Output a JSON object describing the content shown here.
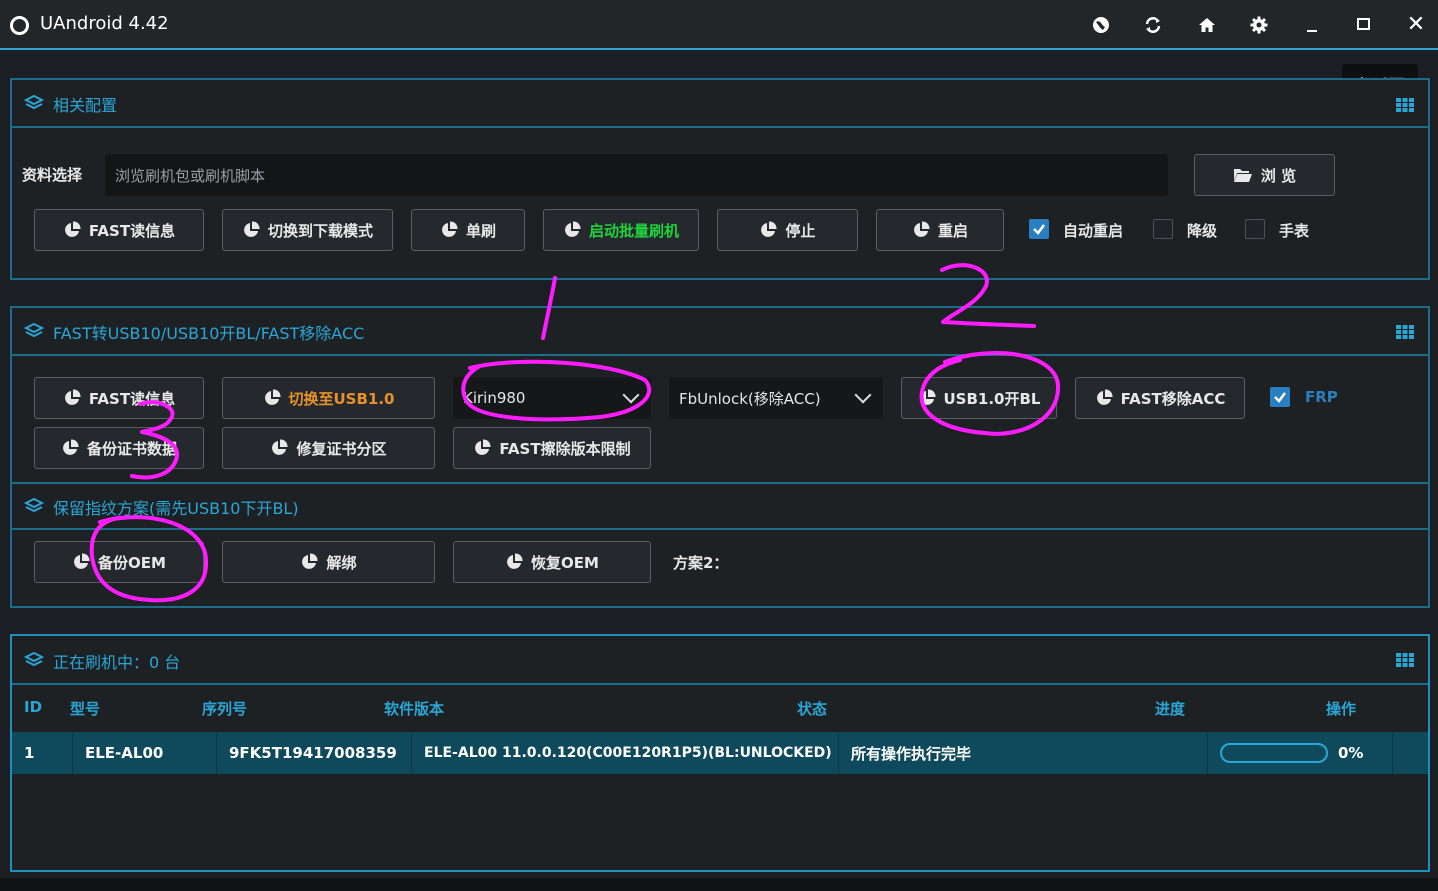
{
  "app": {
    "title": "UAndroid 4.42"
  },
  "titlebar_icons": [
    "globe-icon",
    "refresh-icon",
    "home-icon",
    "gear-icon",
    "minimize-icon",
    "maximize-icon",
    "close-icon"
  ],
  "back_button": {
    "label": "返回"
  },
  "config_panel": {
    "title": "相关配置",
    "file_label": "资料选择",
    "file_placeholder": "浏览刷机包或刷机脚本",
    "browse_label": "浏 览",
    "buttons": [
      "FAST读信息",
      "切换到下载模式",
      "单刷",
      "启动批量刷机",
      "停止",
      "重启"
    ],
    "checkboxes": [
      {
        "label": "自动重启",
        "checked": true
      },
      {
        "label": "降级",
        "checked": false
      },
      {
        "label": "手表",
        "checked": false
      }
    ]
  },
  "fast_panel": {
    "title": "FAST转USB10/USB10开BL/FAST移除ACC",
    "row1_buttons": [
      "FAST读信息",
      "切换至USB1.0"
    ],
    "chip_select": "Kirin980",
    "mode_select": "FbUnlock(移除ACC)",
    "row1_buttons_right": [
      "USB1.0开BL",
      "FAST移除ACC"
    ],
    "frp": {
      "label": "FRP",
      "checked": true
    },
    "row2_buttons": [
      "备份证书数据",
      "修复证书分区",
      "FAST擦除版本限制"
    ]
  },
  "fingerprint_panel": {
    "title": "保留指纹方案(需先USB10下开BL)",
    "buttons": [
      "备份OEM",
      "解绑",
      "恢复OEM"
    ],
    "scheme_label": "方案2："
  },
  "flash_panel": {
    "title": "正在刷机中：0 台",
    "columns": [
      "ID",
      "型号",
      "序列号",
      "软件版本",
      "状态",
      "进度",
      "操作"
    ],
    "rows": [
      {
        "id": "1",
        "model": "ELE-AL00",
        "serial": "9FK5T19417008359",
        "version": "ELE-AL00 11.0.0.120(C00E120R1P5)(BL:UNLOCKED)",
        "status": "所有操作执行完毕",
        "progress": 0,
        "progress_text": "0%"
      }
    ]
  },
  "colors": {
    "accent": "#2aa6d6",
    "green": "#20d23c",
    "orange": "#e8912a",
    "annotation": "#ff1cff"
  }
}
